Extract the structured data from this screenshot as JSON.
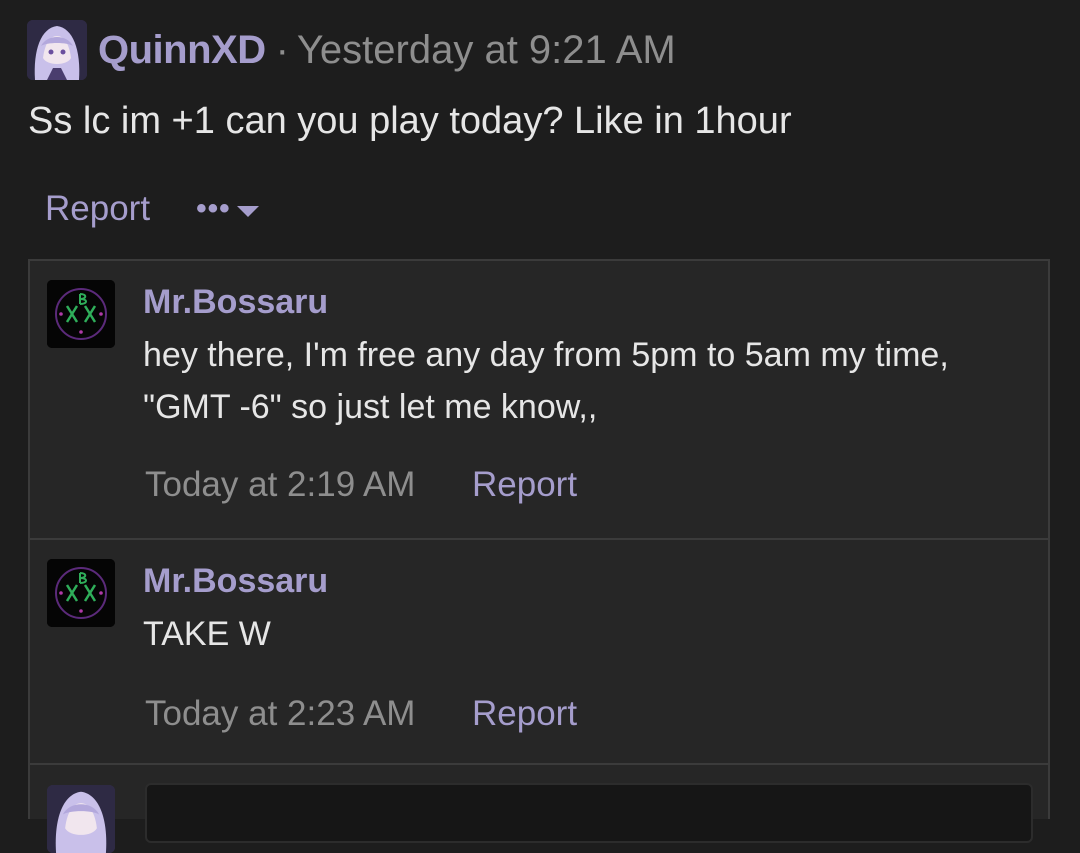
{
  "post": {
    "author": "QuinnXD",
    "separator": "·",
    "timestamp": "Yesterday at 9:21 AM",
    "body": "Ss lc im +1 can you play today? Like in 1hour",
    "report_label": "Report",
    "more_label": "•••"
  },
  "comments": [
    {
      "author": "Mr.Bossaru",
      "lines": [
        "hey there, I'm free any day from 5pm to 5am my time,",
        "\"GMT -6\" so just let me know,,"
      ],
      "timestamp": "Today at 2:19 AM",
      "report_label": "Report"
    },
    {
      "author": "Mr.Bossaru",
      "lines": [
        "TAKE W"
      ],
      "timestamp": "Today at 2:23 AM",
      "report_label": "Report"
    }
  ],
  "colors": {
    "background": "#1d1d1d",
    "panel": "#262626",
    "accent": "#a59dcc",
    "muted": "#8e8e8e",
    "text": "#e6e6e6"
  },
  "icons": {
    "more": "ellipsis-icon",
    "caret": "caret-down-icon"
  }
}
